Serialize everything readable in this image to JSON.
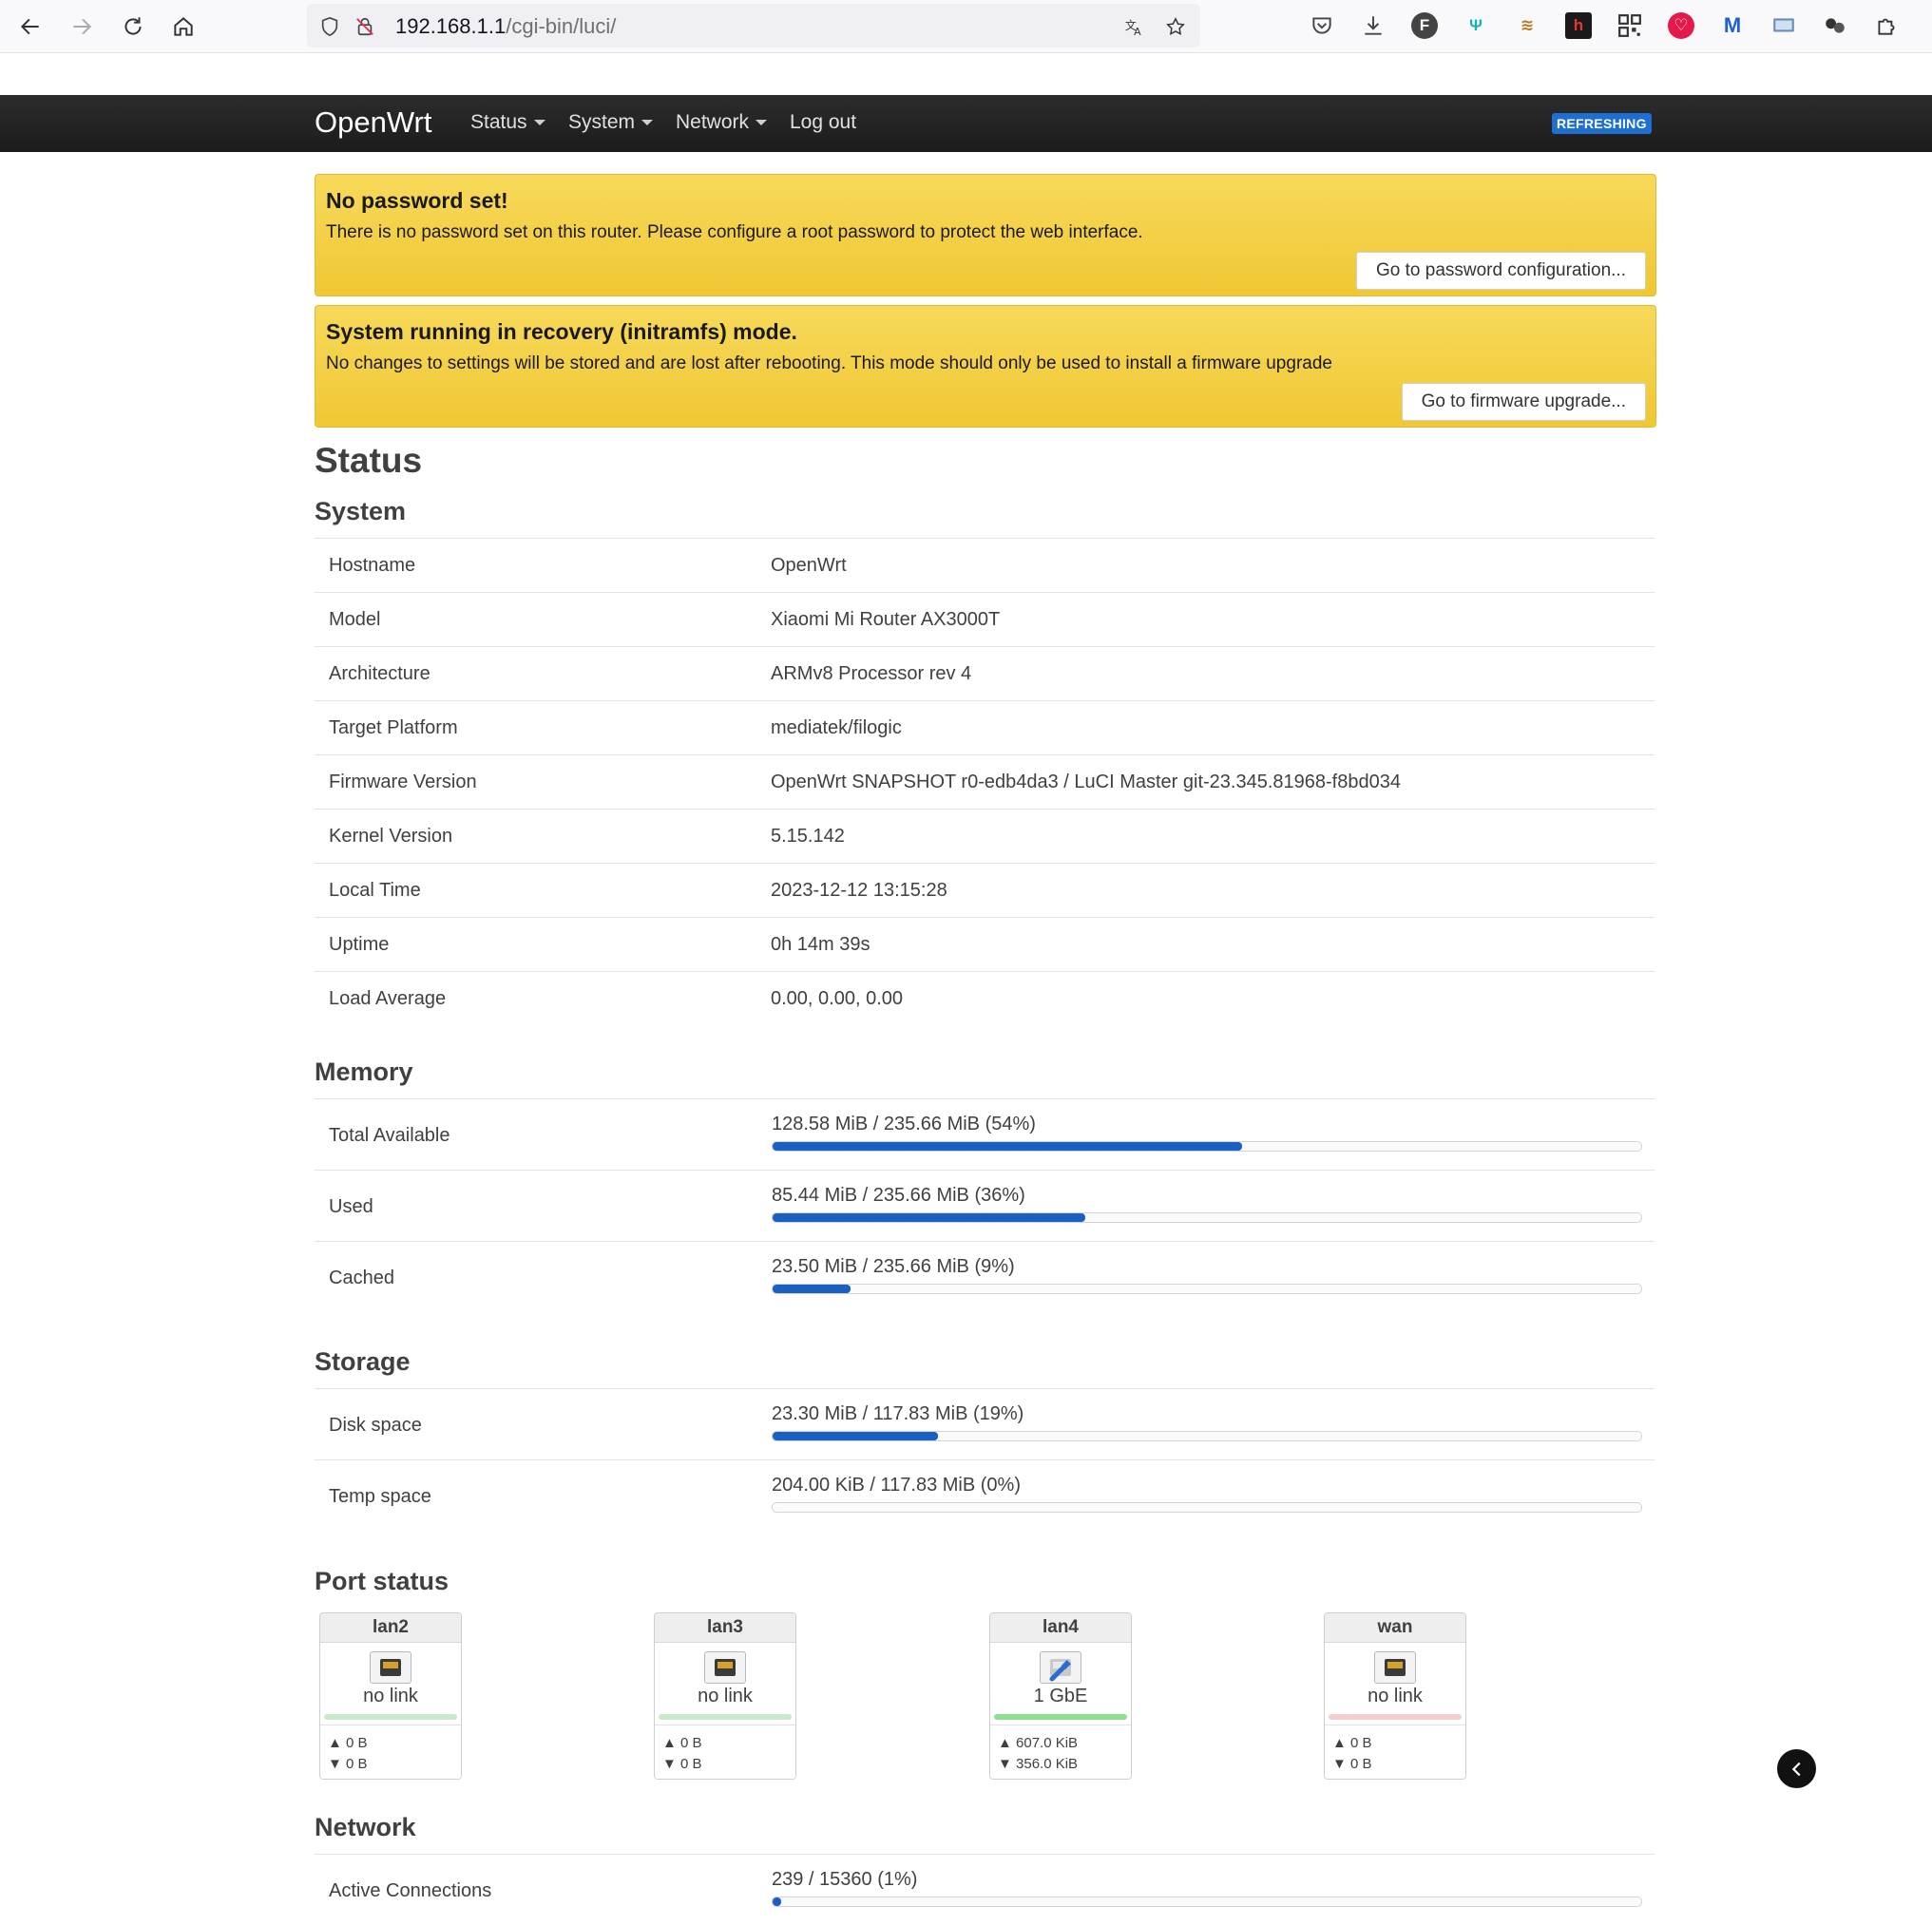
{
  "browser": {
    "url_host": "192.168.1.1",
    "url_path": "/cgi-bin/luci/"
  },
  "header": {
    "brand": "OpenWrt",
    "menu": [
      "Status",
      "System",
      "Network",
      "Log out"
    ],
    "badge": "REFRESHING"
  },
  "alerts": [
    {
      "title": "No password set!",
      "text": "There is no password set on this router. Please configure a root password to protect the web interface.",
      "button": "Go to password configuration..."
    },
    {
      "title": "System running in recovery (initramfs) mode.",
      "text": "No changes to settings will be stored and are lost after rebooting. This mode should only be used to install a firmware upgrade",
      "button": "Go to firmware upgrade..."
    }
  ],
  "page_title": "Status",
  "system": {
    "title": "System",
    "rows": [
      {
        "key": "Hostname",
        "value": "OpenWrt"
      },
      {
        "key": "Model",
        "value": "Xiaomi Mi Router AX3000T"
      },
      {
        "key": "Architecture",
        "value": "ARMv8 Processor rev 4"
      },
      {
        "key": "Target Platform",
        "value": "mediatek/filogic"
      },
      {
        "key": "Firmware Version",
        "value": "OpenWrt SNAPSHOT r0-edb4da3 / LuCI Master git-23.345.81968-f8bd034"
      },
      {
        "key": "Kernel Version",
        "value": "5.15.142"
      },
      {
        "key": "Local Time",
        "value": "2023-12-12 13:15:28"
      },
      {
        "key": "Uptime",
        "value": "0h 14m 39s"
      },
      {
        "key": "Load Average",
        "value": "0.00, 0.00, 0.00"
      }
    ]
  },
  "memory": {
    "title": "Memory",
    "rows": [
      {
        "key": "Total Available",
        "text": "128.58 MiB / 235.66 MiB (54%)",
        "percent": 54
      },
      {
        "key": "Used",
        "text": "85.44 MiB / 235.66 MiB (36%)",
        "percent": 36
      },
      {
        "key": "Cached",
        "text": "23.50 MiB / 235.66 MiB (9%)",
        "percent": 9
      }
    ]
  },
  "storage": {
    "title": "Storage",
    "rows": [
      {
        "key": "Disk space",
        "text": "23.30 MiB / 117.83 MiB (19%)",
        "percent": 19
      },
      {
        "key": "Temp space",
        "text": "204.00 KiB / 117.83 MiB (0%)",
        "percent": 0
      }
    ]
  },
  "ports": {
    "title": "Port status",
    "items": [
      {
        "name": "lan2",
        "speed": "no link",
        "tx": "▲ 0 B",
        "rx": "▼ 0 B",
        "line_color": "#c9e9c9",
        "linked": false
      },
      {
        "name": "lan3",
        "speed": "no link",
        "tx": "▲ 0 B",
        "rx": "▼ 0 B",
        "line_color": "#c9e9c9",
        "linked": false
      },
      {
        "name": "lan4",
        "speed": "1 GbE",
        "tx": "▲ 607.0 KiB",
        "rx": "▼ 356.0 KiB",
        "line_color": "#8ee08e",
        "linked": true
      },
      {
        "name": "wan",
        "speed": "no link",
        "tx": "▲ 0 B",
        "rx": "▼ 0 B",
        "line_color": "#f3cfcf",
        "linked": false
      }
    ]
  },
  "network": {
    "title": "Network",
    "rows": [
      {
        "key": "Active Connections",
        "text": "239 / 15360 (1%)",
        "percent": 1
      }
    ]
  }
}
